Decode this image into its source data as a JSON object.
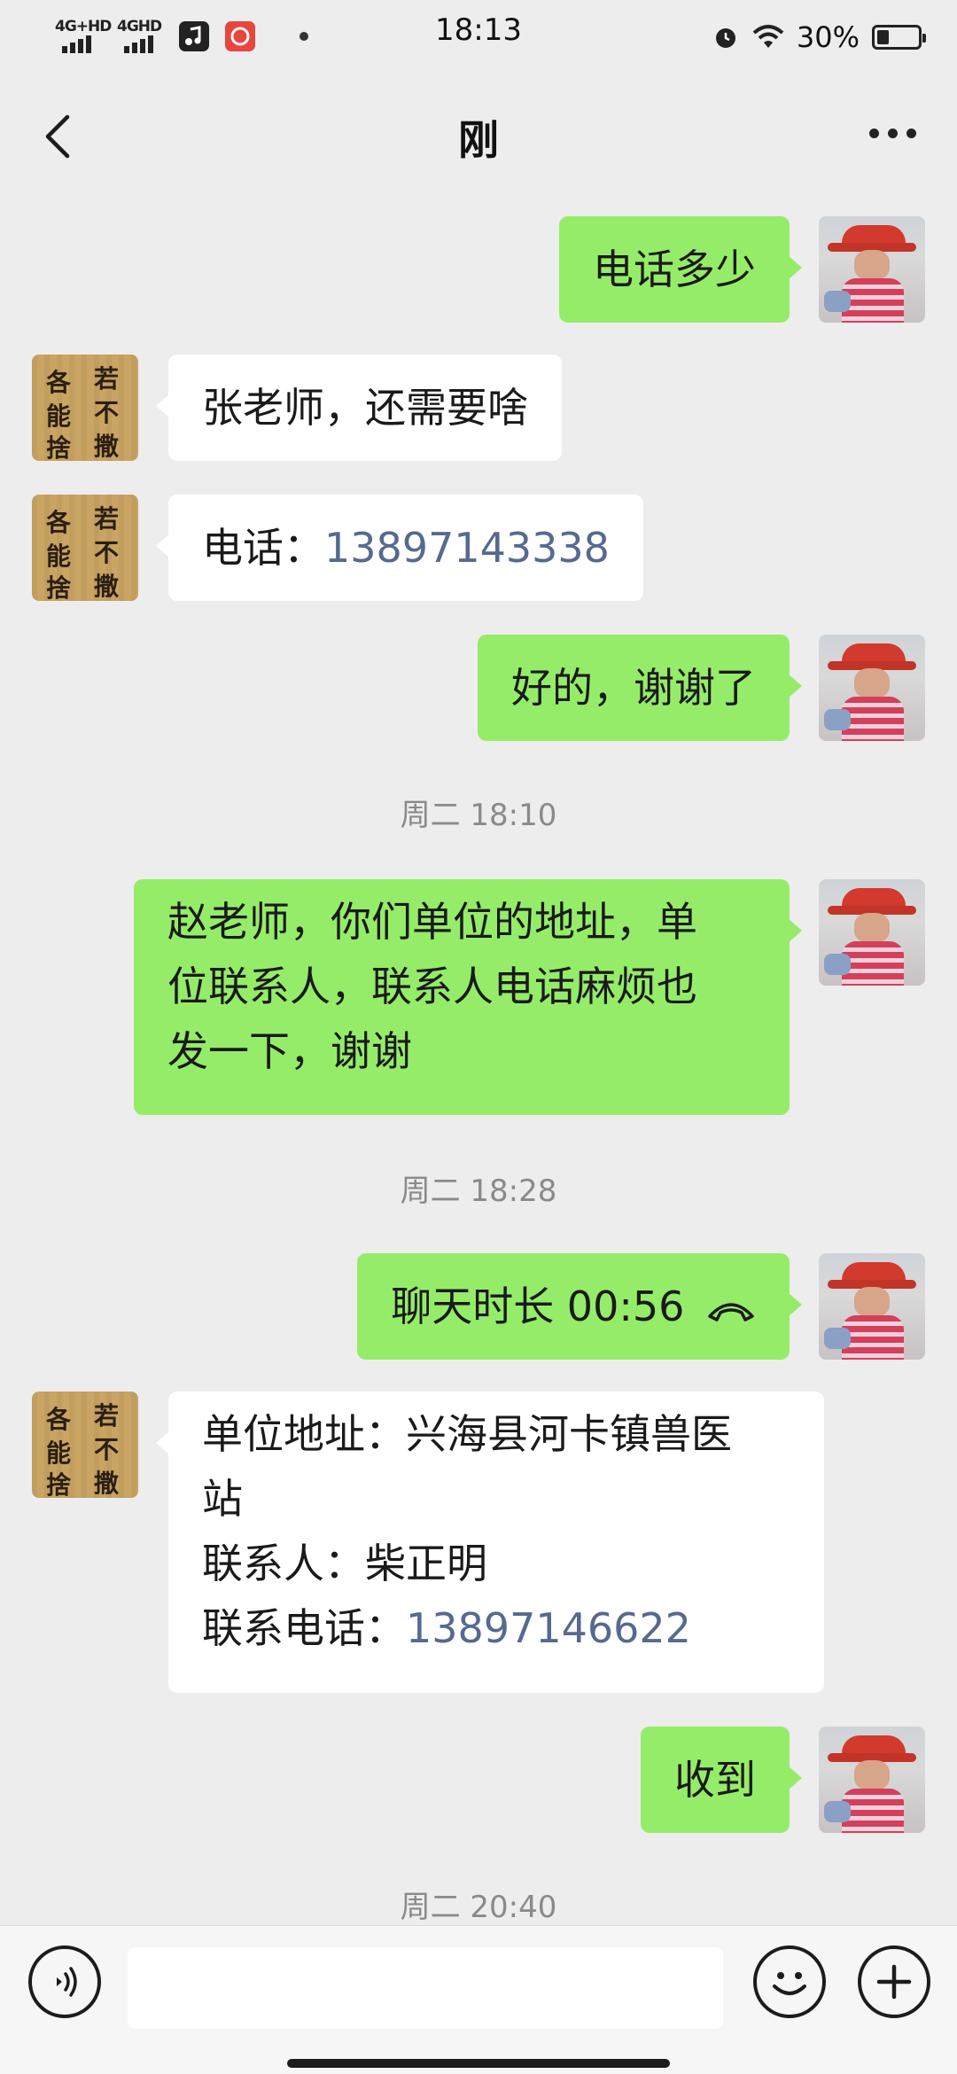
{
  "status_bar": {
    "signal1_label": "4G+HD",
    "signal2_label": "4GHD",
    "time": "18:13",
    "battery_percent": "30%",
    "battery_level": 0.3
  },
  "header": {
    "title": "刚"
  },
  "messages": {
    "m1": {
      "text": "电话多少"
    },
    "m2": {
      "text": "张老师，还需要啥"
    },
    "m3": {
      "prefix": "电话：",
      "phone": "13897143338"
    },
    "m4": {
      "text": "好的，谢谢了"
    },
    "t1": "周二 18:10",
    "m5": {
      "line1": "赵老师，你们单位的地址，单",
      "line2": "位联系人，联系人电话麻烦也",
      "line3": "发一下，谢谢"
    },
    "t2": "周二 18:28",
    "m6": {
      "text": "聊天时长 00:56"
    },
    "m7": {
      "line1": "单位地址：兴海县河卡镇兽医",
      "line2": "站",
      "line3": "联系人：柴正明",
      "line4_prefix": "联系电话：",
      "line4_phone": "13897146622"
    },
    "m8": {
      "text": "收到"
    },
    "t3": "周二 20:40"
  },
  "avatar_other": {
    "chars": [
      "各",
      "若",
      "能",
      "不",
      "捨",
      "撒"
    ]
  },
  "colors": {
    "outgoing_bubble": "#95ec69",
    "incoming_bubble": "#ffffff",
    "background": "#ededed",
    "phone_link": "#56698f"
  }
}
